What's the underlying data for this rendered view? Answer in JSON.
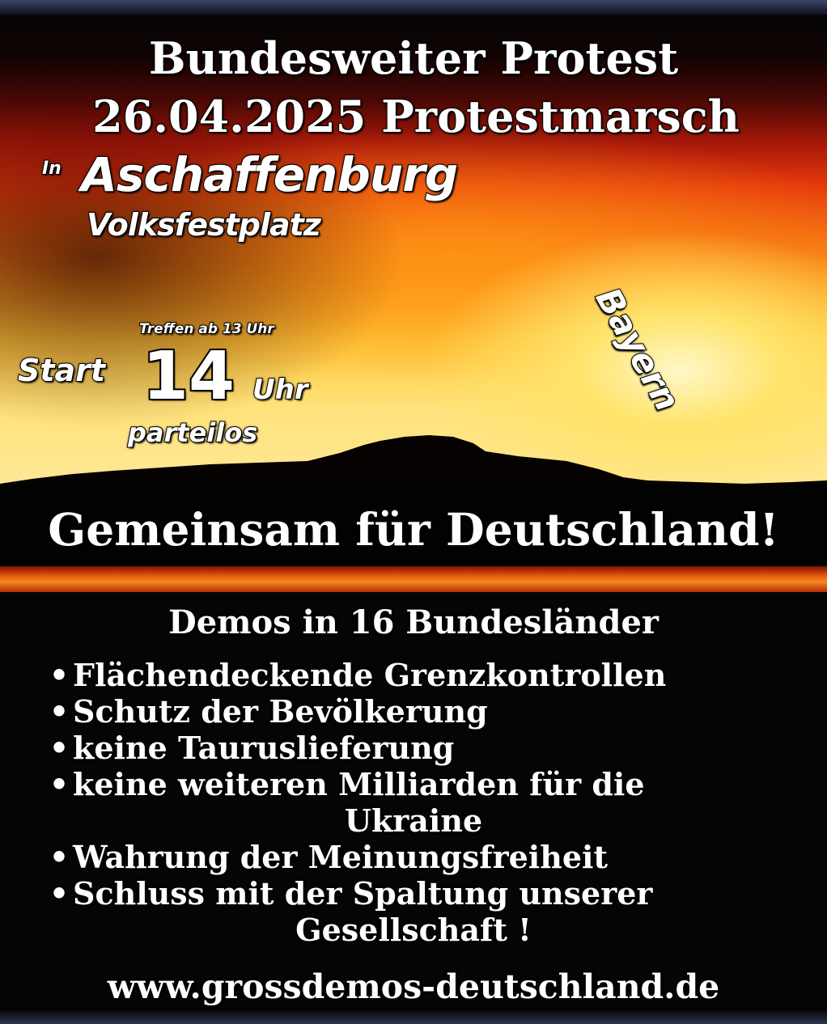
{
  "headline": {
    "line1": "Bundesweiter Protest",
    "line2": "26.04.2025 Protestmarsch",
    "prefix": "In",
    "city": "Aschaffenburg",
    "venue": "Volksfestplatz",
    "region_badge": "Bayern"
  },
  "time": {
    "meeting": "Treffen ab 13 Uhr",
    "start_label": "Start",
    "hour": "14",
    "unit": "Uhr",
    "affiliation": "parteilos"
  },
  "slogan": "Gemeinsam für Deutschland!",
  "demands": {
    "heading": "Demos in 16 Bundesländer",
    "items": [
      "Flächendeckende Grenzkontrollen",
      "Schutz der Bevölkerung",
      "keine Tauruslieferung",
      "keine weiteren Milliarden für die",
      "Ukraine",
      "Wahrung der Meinungsfreiheit",
      "Schluss mit der Spaltung unserer",
      "Gesellschaft !"
    ],
    "bullet": "•"
  },
  "website": "www.grossdemos-deutschland.de",
  "colors": {
    "text": "#ffffff",
    "outline": "#000000",
    "sky_top": "#a9180a",
    "sky_mid": "#f36a12",
    "sky_glow": "#ffe36a",
    "background": "#050505"
  }
}
